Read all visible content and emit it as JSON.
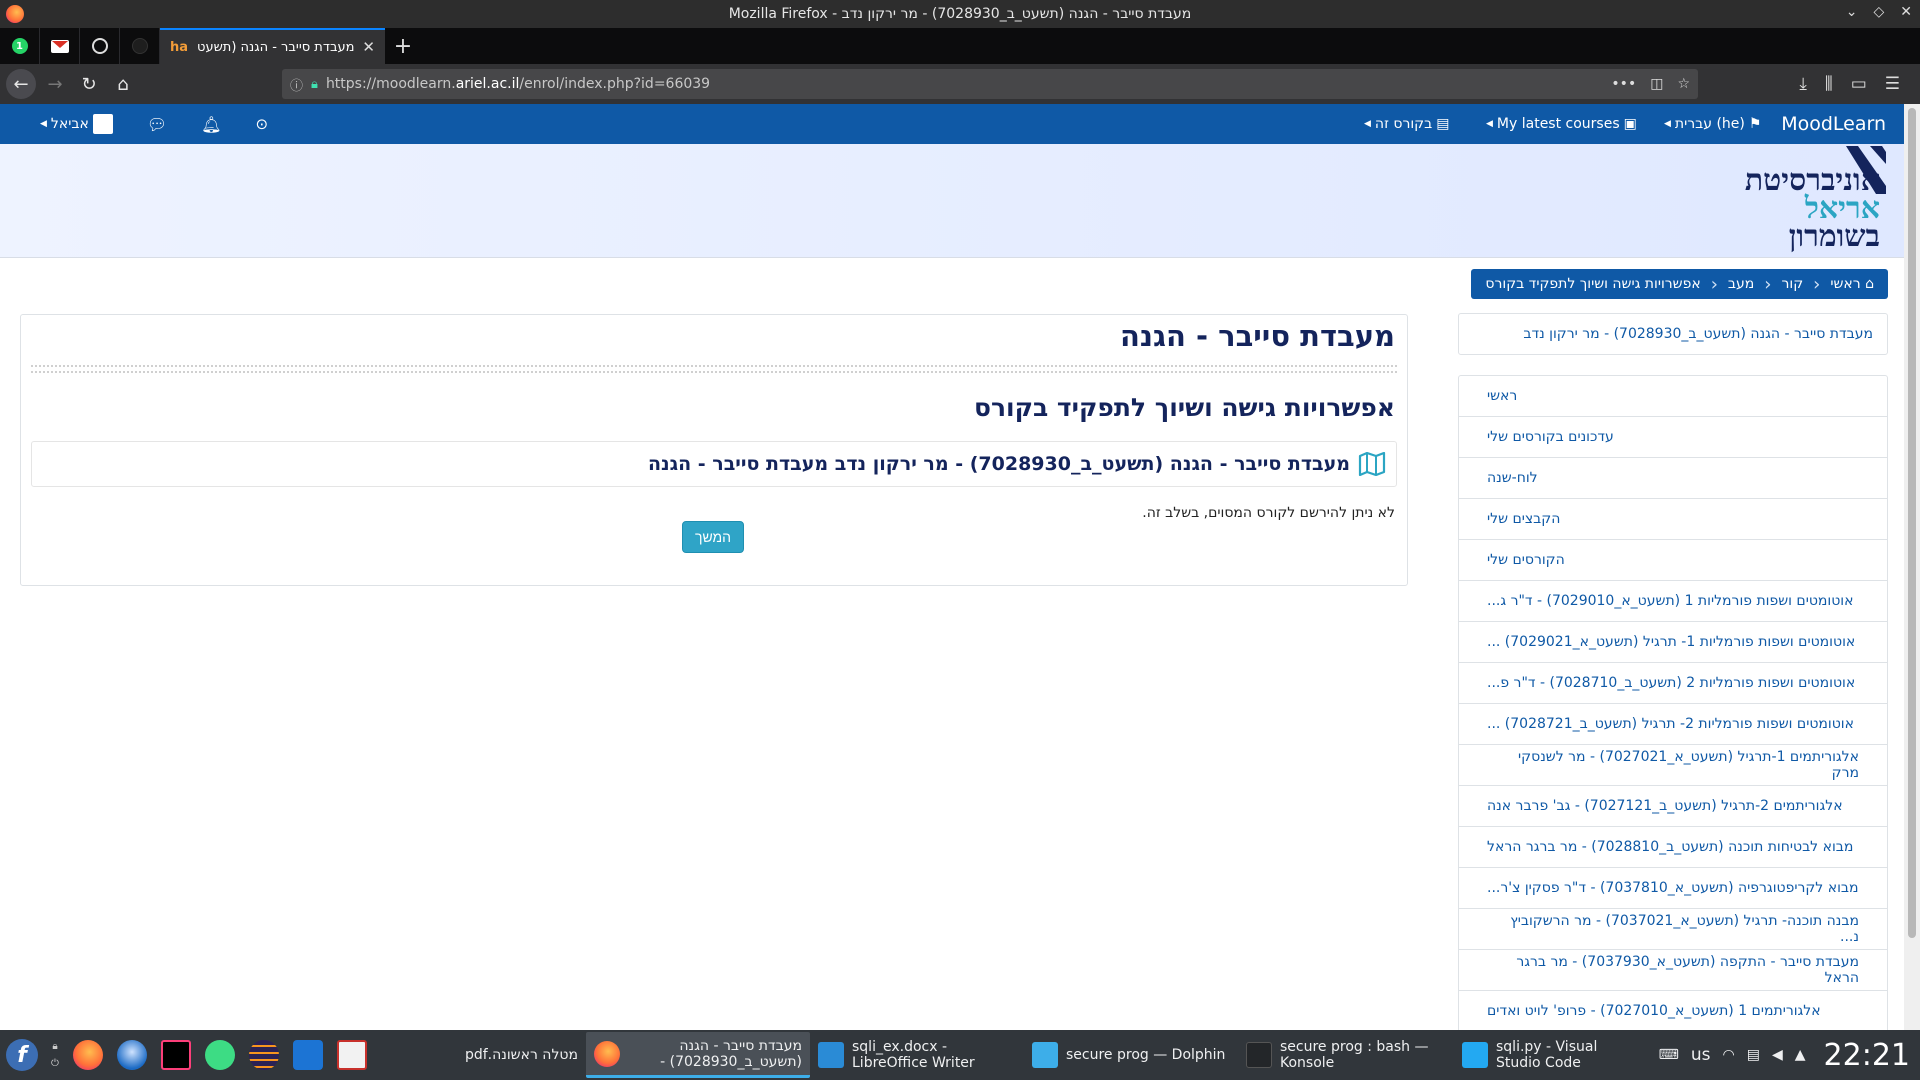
{
  "window": {
    "title": "Mozilla Firefox - מעבדת סייבר - הגנה (תשעט_ב_7028930) - מר ירקון נדב",
    "controls": [
      "⌄",
      "◇",
      "✕"
    ]
  },
  "tabs": {
    "active_title": "מעבדת סייבר - הגנה (תשעט",
    "active_favicon": "ha",
    "whatsapp_badge": "1",
    "new_tab": "+"
  },
  "nav": {
    "url_prefix": "https://moodlearn.",
    "url_domain": "ariel.ac.il",
    "url_suffix": "/enrol/index.php?id=66039",
    "page_actions": "•••"
  },
  "moodle": {
    "brand": "MoodLearn",
    "lang_menu": "עברית (he)",
    "latest_courses": "My latest courses",
    "this_course": "בקורס זה",
    "user_name": "אביאל"
  },
  "logo": {
    "line1": "אוניברסיטת",
    "line2": "אריאל",
    "line3": "בשומרון"
  },
  "breadcrumb": [
    "ראשי",
    "קור",
    "מעב",
    "אפשרויות גישה ושיוך לתפקיד בקורס"
  ],
  "sidebar": {
    "course_link": "מעבדת סייבר - הגנה (תשעט_ב_7028930) - מר ירקון נדב",
    "items": [
      "ראשי",
      "עדכונים בקורסים שלי",
      "לוח-שנה",
      "הקבצים שלי",
      "הקורסים שלי",
      "אוטומטים ושפות פורמליות 1 (תשעט_א_7029010) - ד\"ר ג...",
      "אוטומטים ושפות פורמליות 1- תרגיל (תשעט_א_7029021) ...",
      "אוטומטים ושפות פורמליות 2 (תשעט_ב_7028710) - ד\"ר פ...",
      "אוטומטים ושפות פורמליות 2- תרגיל (תשעט_ב_7028721) ...",
      "אלגוריתמים 1-תרגיל (תשעט_א_7027021) - מר לשנסקי מרק",
      "אלגוריתמים 2-תרגיל (תשעט_ב_7027121) - גב' פרבר אנה",
      "מבוא לבטיחות תוכנה (תשעט_ב_7028810) - מר ברגר הראל",
      "מבוא לקריפטוגרפיה (תשעט_א_7037810) - ד\"ר פסקין צ'ר...",
      "מבנה תוכנה- תרגיל (תשעט_א_7037021) - מר הרשקוביץ נ...",
      "מעבדת סייבר - התקפה (תשעט_א_7037930) - מר ברגר הראל",
      "אלגוריתמים 1 (תשעט_א_7027010) - פרופ' לויט ואדים"
    ]
  },
  "main": {
    "course_title": "מעבדת סייבר - הגנה",
    "section_title": "אפשרויות גישה ושיוך לתפקיד בקורס",
    "enrol_name": "מעבדת סייבר - הגנה (תשעט_ב_7028930) - מר ירקון נדב מעבדת סייבר - הגנה",
    "notice": "לא ניתן להירשם לקורס המסוים, בשלב זה.",
    "continue_label": "המשך"
  },
  "taskbar": {
    "tasks": [
      {
        "label": "מטלה ראשונה.pdf",
        "icon": "pdf-icon"
      },
      {
        "label": "מעבדת סייבר - הגנה (תשעט_ב_7028930) - מר...",
        "icon": "firefox-icon"
      },
      {
        "label": "sqli_ex.docx - LibreOffice Writer",
        "icon": "writer-icon"
      },
      {
        "label": "secure prog — Dolphin",
        "icon": "folder-icon"
      },
      {
        "label": "secure prog : bash — Konsole",
        "icon": "terminal-icon"
      },
      {
        "label": "sqli.py - Visual Studio Code",
        "icon": "vscode-icon"
      }
    ],
    "keyboard_layout": "us",
    "clock": "22:21"
  }
}
